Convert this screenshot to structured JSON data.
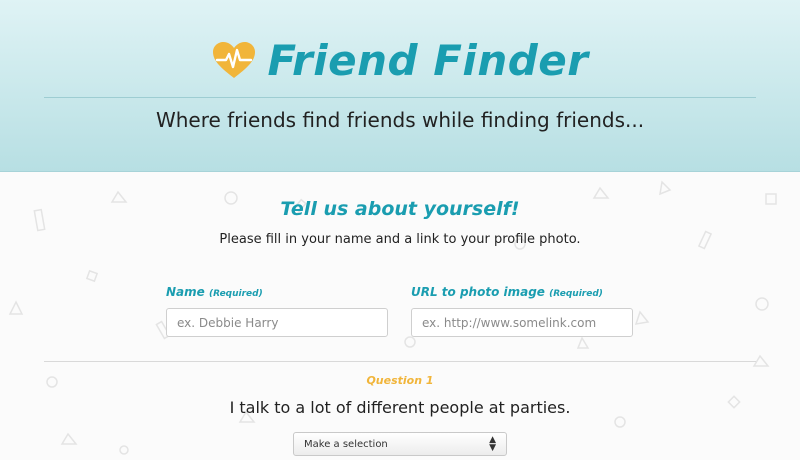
{
  "header": {
    "title": "Friend Finder",
    "tagline": "Where friends find friends while finding friends..."
  },
  "intro": {
    "title": "Tell us about yourself!",
    "subtitle": "Please fill in your name and a link to your profile photo."
  },
  "form": {
    "name": {
      "label": "Name",
      "required": "(Required)",
      "placeholder": "ex. Debbie Harry"
    },
    "photo": {
      "label": "URL to photo image",
      "required": "(Required)",
      "placeholder": "ex. http://www.somelink.com"
    }
  },
  "question": {
    "number": "Question 1",
    "text": "I talk to a lot of different people at parties.",
    "select_value": "Make a selection"
  },
  "colors": {
    "accent": "#1a9db0",
    "heart": "#f1b53a",
    "header_bg": "#b7dfe3"
  },
  "icons": [
    "heart-pulse-icon",
    "select-arrows-icon"
  ]
}
